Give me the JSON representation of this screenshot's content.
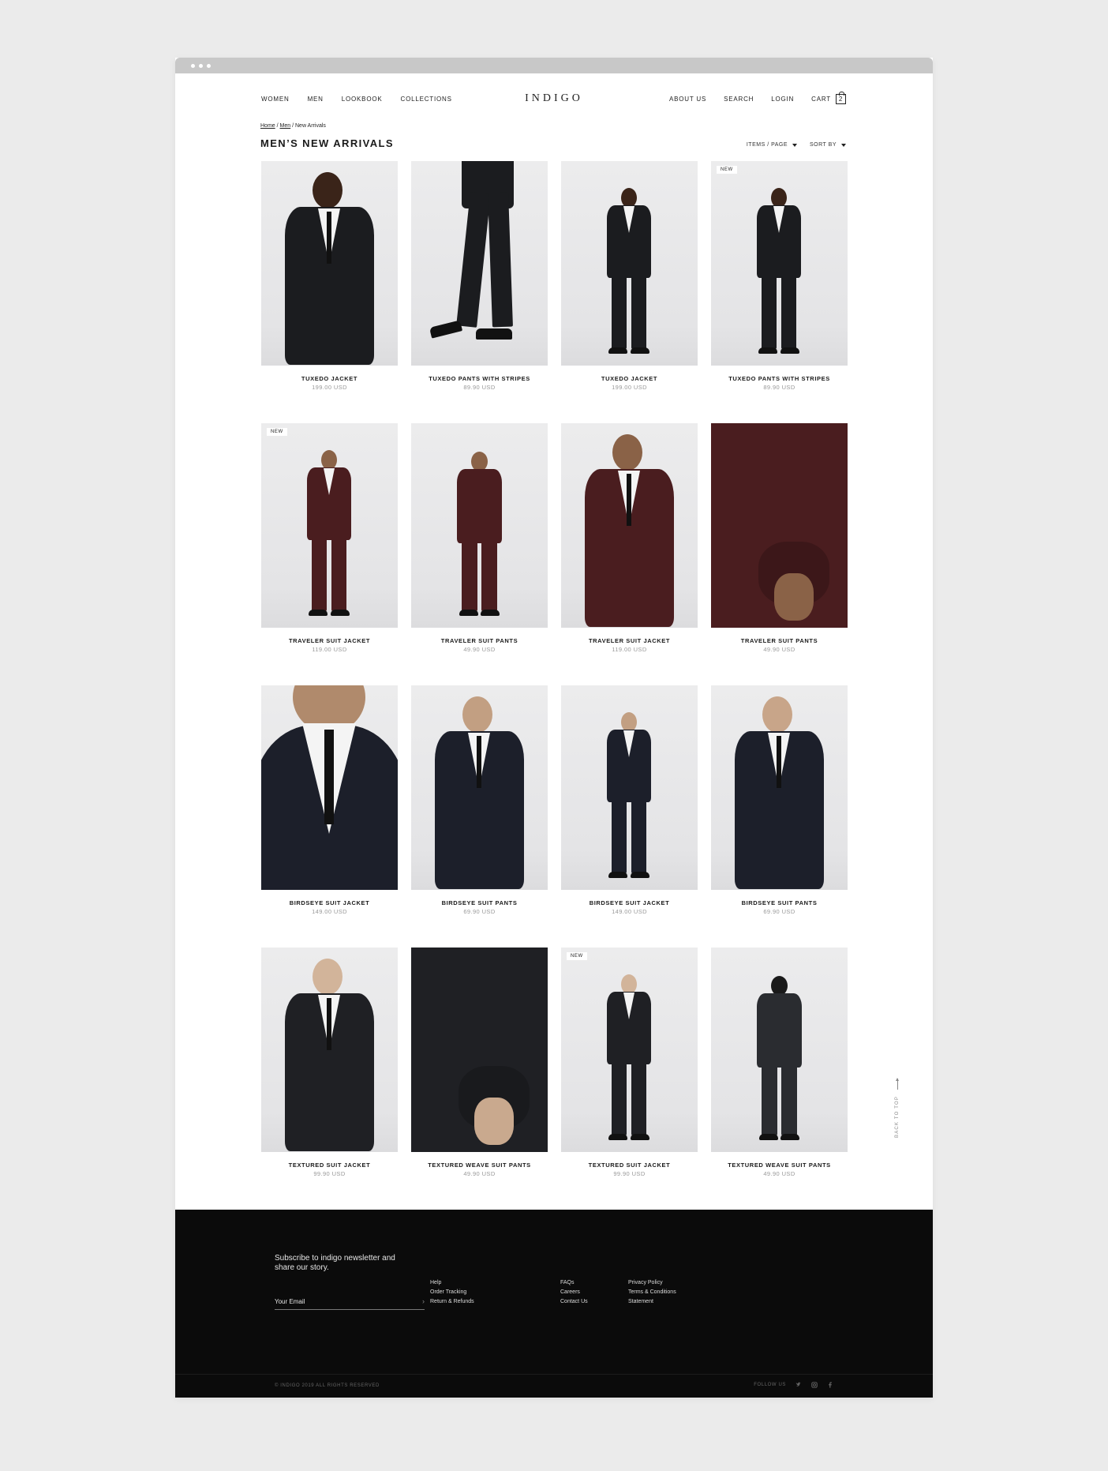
{
  "nav": {
    "left": [
      "WOMEN",
      "MEN",
      "LOOKBOOK",
      "COLLECTIONS"
    ],
    "logo": "INDIGO",
    "right": [
      "ABOUT US",
      "SEARCH",
      "LOGIN"
    ],
    "cart_label": "CART",
    "cart_count": "2"
  },
  "breadcrumb": {
    "home": "Home",
    "men": "Men",
    "current": "New Arrivals",
    "sep": " / "
  },
  "page_title": "MEN’S NEW ARRIVALS",
  "controls": {
    "items_per_page": "ITEMS / PAGE",
    "sort_by": "SORT BY"
  },
  "products": [
    {
      "name": "TUXEDO JACKET",
      "price": "199.00 USD",
      "badge": "",
      "suit": "#1b1c1f",
      "skin": "#3a2419",
      "view": "front"
    },
    {
      "name": "TUXEDO PANTS WITH STRIPES",
      "price": "89.90 USD",
      "badge": "",
      "suit": "#1b1c1f",
      "skin": "#3a2419",
      "view": "legs"
    },
    {
      "name": "TUXEDO JACKET",
      "price": "199.00 USD",
      "badge": "",
      "suit": "#1b1c1f",
      "skin": "#3a2419",
      "view": "full"
    },
    {
      "name": "TUXEDO PANTS WITH STRIPES",
      "price": "89.90 USD",
      "badge": "NEW",
      "suit": "#1b1c1f",
      "skin": "#3a2419",
      "view": "full"
    },
    {
      "name": "TRAVELER SUIT JACKET",
      "price": "119.00 USD",
      "badge": "NEW",
      "suit": "#4a1d1f",
      "skin": "#8a6247",
      "view": "full"
    },
    {
      "name": "TRAVELER SUIT PANTS",
      "price": "49.90 USD",
      "badge": "",
      "suit": "#4a1d1f",
      "skin": "#8a6247",
      "view": "back"
    },
    {
      "name": "TRAVELER SUIT JACKET",
      "price": "119.00 USD",
      "badge": "",
      "suit": "#4a1d1f",
      "skin": "#8a6247",
      "view": "front"
    },
    {
      "name": "TRAVELER SUIT PANTS",
      "price": "49.90 USD",
      "badge": "",
      "suit": "#4a1d1f",
      "skin": "#8a6247",
      "view": "detail"
    },
    {
      "name": "BIRDSEYE SUIT JACKET",
      "price": "149.00 USD",
      "badge": "",
      "suit": "#1c1f2a",
      "skin": "#b08a6c",
      "view": "close"
    },
    {
      "name": "BIRDSEYE SUIT PANTS",
      "price": "69.90 USD",
      "badge": "",
      "suit": "#1c1f2a",
      "skin": "#c29f82",
      "view": "front"
    },
    {
      "name": "BIRDSEYE SUIT JACKET",
      "price": "149.00 USD",
      "badge": "",
      "suit": "#1c1f2a",
      "skin": "#c29f82",
      "view": "full"
    },
    {
      "name": "BIRDSEYE SUIT PANTS",
      "price": "69.90 USD",
      "badge": "",
      "suit": "#1c1f2a",
      "skin": "#c8a589",
      "view": "front"
    },
    {
      "name": "TEXTURED SUIT JACKET",
      "price": "99.90 USD",
      "badge": "",
      "suit": "#1f2024",
      "skin": "#d2b49a",
      "view": "front"
    },
    {
      "name": "TEXTURED WEAVE SUIT PANTS",
      "price": "49.90 USD",
      "badge": "",
      "suit": "#1f2024",
      "skin": "#c9a98e",
      "view": "detail"
    },
    {
      "name": "TEXTURED SUIT JACKET",
      "price": "99.90 USD",
      "badge": "NEW",
      "suit": "#1f2024",
      "skin": "#d2b49a",
      "view": "full"
    },
    {
      "name": "TEXTURED WEAVE SUIT PANTS",
      "price": "49.90 USD",
      "badge": "",
      "suit": "#2a2c30",
      "skin": "#1a1a1a",
      "view": "back"
    }
  ],
  "back_to_top": "BACK TO TOP",
  "footer": {
    "newsletter": "Subscribe to indigo newsletter and share our story.",
    "email_placeholder": "Your Email",
    "col1": [
      "Help",
      "Order Tracking",
      "Return & Refunds"
    ],
    "col2": [
      "FAQs",
      "Careers",
      "Contact Us"
    ],
    "col3": [
      "Privacy Policy",
      "Terms & Conditions",
      "Statement"
    ],
    "copyright": "© INDIGO 2019 ALL RIGHTS RESERVED",
    "follow": "FOLLOW US",
    "social": [
      "twitter-icon",
      "instagram-icon",
      "facebook-icon"
    ]
  }
}
